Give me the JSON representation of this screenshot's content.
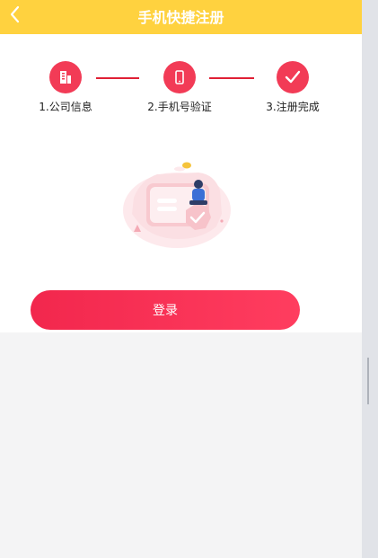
{
  "header": {
    "title": "手机快捷注册"
  },
  "steps": [
    {
      "number_label": "1.公司信息",
      "icon": "building-icon"
    },
    {
      "number_label": "2.手机号验证",
      "icon": "phone-icon"
    },
    {
      "number_label": "3.注册完成",
      "icon": "check-icon"
    }
  ],
  "login_button": {
    "label": "登录"
  },
  "colors": {
    "header_bg": "#ffd23f",
    "accent": "#f23b56"
  }
}
